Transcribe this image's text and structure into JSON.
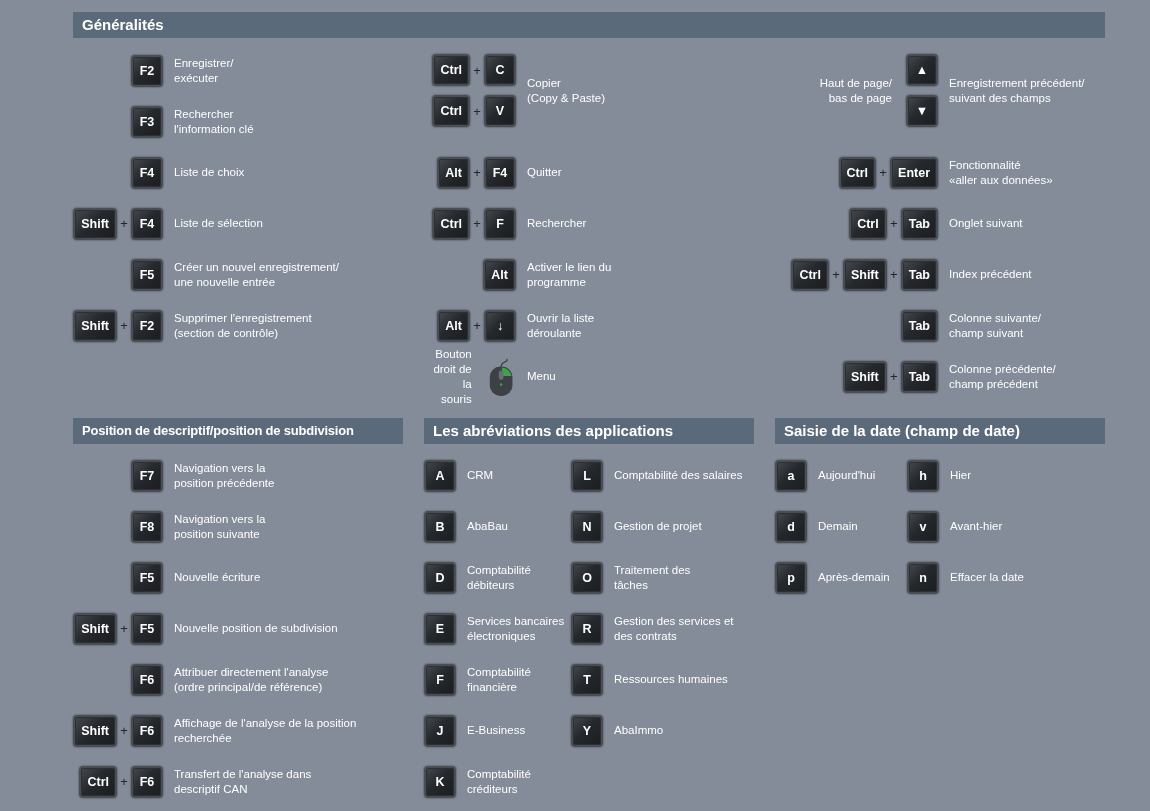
{
  "general": {
    "title": "Généralités",
    "columns": [
      {
        "rows": [
          {
            "kind": "combo",
            "keys": [
              "F2"
            ],
            "text": "Enregistrer/\nexécuter"
          },
          {
            "kind": "combo",
            "keys": [
              "F3"
            ],
            "text": "Rechercher\nl'information clé"
          },
          {
            "kind": "combo",
            "keys": [
              "F4"
            ],
            "text": "Liste de choix"
          },
          {
            "kind": "combo",
            "keys": [
              "Shift",
              "+",
              "F4"
            ],
            "text": "Liste de sélection"
          },
          {
            "kind": "combo",
            "keys": [
              "F5"
            ],
            "text": "Créer un nouvel enregistrement/\nune nouvelle entrée"
          },
          {
            "kind": "combo",
            "keys": [
              "Shift",
              "+",
              "F2"
            ],
            "text": "Supprimer l'enregistrement\n(section de contrôle)"
          }
        ]
      },
      {
        "rows": [
          {
            "kind": "stack",
            "combos": [
              [
                "Ctrl",
                "+",
                "C"
              ],
              [
                "Ctrl",
                "+",
                "V"
              ]
            ],
            "text": "Copier\n(Copy & Paste)"
          },
          {
            "kind": "combo",
            "keys": [
              "Alt",
              "+",
              "F4"
            ],
            "text": "Quitter"
          },
          {
            "kind": "combo",
            "keys": [
              "Ctrl",
              "+",
              "F"
            ],
            "text": "Rechercher"
          },
          {
            "kind": "combo",
            "keys": [
              "Alt"
            ],
            "text": "Activer le lien du\nprogramme"
          },
          {
            "kind": "combo",
            "keys": [
              "Alt",
              "+",
              "↓"
            ],
            "text": "Ouvrir la liste\ndéroulante"
          },
          {
            "kind": "mouse",
            "side_label": "Bouton\ndroit de la\nsouris",
            "text": "Menu"
          }
        ]
      },
      {
        "rows": [
          {
            "kind": "stack",
            "side_label": "Haut de page/\nbas de page",
            "combos": [
              [
                "▲"
              ],
              [
                "▼"
              ]
            ],
            "text": "Enregistrement précédent/\nsuivant des champs"
          },
          {
            "kind": "combo",
            "keys": [
              "Ctrl",
              "+",
              "Enter"
            ],
            "text": "Fonctionnalité\n«aller aux données»"
          },
          {
            "kind": "combo",
            "keys": [
              "Ctrl",
              "+",
              "Tab"
            ],
            "text": "Onglet suivant"
          },
          {
            "kind": "combo",
            "keys": [
              "Ctrl",
              "+",
              "Shift",
              "+",
              "Tab"
            ],
            "text": "Index précédent"
          },
          {
            "kind": "combo",
            "keys": [
              "Tab"
            ],
            "text": "Colonne suivante/\nchamp suivant"
          },
          {
            "kind": "combo",
            "keys": [
              "Shift",
              "+",
              "Tab"
            ],
            "text": "Colonne précédente/\nchamp précédent"
          }
        ]
      }
    ]
  },
  "sections": [
    {
      "title": "Position de descriptif/position de subdivision",
      "columns": [
        {
          "rows": [
            {
              "kind": "combo",
              "keys": [
                "F7"
              ],
              "text": "Navigation vers la\nposition précédente"
            },
            {
              "kind": "combo",
              "keys": [
                "F8"
              ],
              "text": "Navigation vers la\nposition suivante"
            },
            {
              "kind": "combo",
              "keys": [
                "F5"
              ],
              "text": "Nouvelle écriture"
            },
            {
              "kind": "combo",
              "keys": [
                "Shift",
                "+",
                "F5"
              ],
              "text": "Nouvelle position de subdivision"
            },
            {
              "kind": "combo",
              "keys": [
                "F6"
              ],
              "text": "Attribuer directement l'analyse\n(ordre principal/de référence)"
            },
            {
              "kind": "combo",
              "keys": [
                "Shift",
                "+",
                "F6"
              ],
              "text": "Affichage de l'analyse de la position\nrecherchée"
            },
            {
              "kind": "combo",
              "keys": [
                "Ctrl",
                "+",
                "F6"
              ],
              "text": "Transfert de l'analyse dans\ndescriptif CAN"
            }
          ]
        }
      ]
    },
    {
      "title": "Les abréviations des applications",
      "columns": [
        {
          "rows": [
            {
              "kind": "combo",
              "keys": [
                "A"
              ],
              "text": "CRM"
            },
            {
              "kind": "combo",
              "keys": [
                "B"
              ],
              "text": "AbaBau"
            },
            {
              "kind": "combo",
              "keys": [
                "D"
              ],
              "text": "Comptabilité\ndébiteurs"
            },
            {
              "kind": "combo",
              "keys": [
                "E"
              ],
              "text": "Services bancaires\nélectroniques"
            },
            {
              "kind": "combo",
              "keys": [
                "F"
              ],
              "text": "Comptabilité\nfinancière"
            },
            {
              "kind": "combo",
              "keys": [
                "J"
              ],
              "text": "E-Business"
            },
            {
              "kind": "combo",
              "keys": [
                "K"
              ],
              "text": "Comptabilité\ncréditeurs"
            }
          ]
        },
        {
          "rows": [
            {
              "kind": "combo",
              "keys": [
                "L"
              ],
              "text": "Comptabilité des salaires"
            },
            {
              "kind": "combo",
              "keys": [
                "N"
              ],
              "text": "Gestion de projet"
            },
            {
              "kind": "combo",
              "keys": [
                "O"
              ],
              "text": "Traitement des\ntâches"
            },
            {
              "kind": "combo",
              "keys": [
                "R"
              ],
              "text": "Gestion des services et\ndes contrats"
            },
            {
              "kind": "combo",
              "keys": [
                "T"
              ],
              "text": "Ressources humaines"
            },
            {
              "kind": "combo",
              "keys": [
                "Y"
              ],
              "text": "AbaImmo"
            }
          ]
        }
      ]
    },
    {
      "title": "Saisie de la date (champ de date)",
      "columns": [
        {
          "rows": [
            {
              "kind": "combo",
              "keys": [
                "a"
              ],
              "text": "Aujourd'hui"
            },
            {
              "kind": "combo",
              "keys": [
                "d"
              ],
              "text": "Demain"
            },
            {
              "kind": "combo",
              "keys": [
                "p"
              ],
              "text": "Après-demain"
            }
          ]
        },
        {
          "rows": [
            {
              "kind": "combo",
              "keys": [
                "h"
              ],
              "text": "Hier"
            },
            {
              "kind": "combo",
              "keys": [
                "v"
              ],
              "text": "Avant-hier"
            },
            {
              "kind": "combo",
              "keys": [
                "n"
              ],
              "text": "Effacer la date"
            }
          ]
        }
      ]
    }
  ]
}
